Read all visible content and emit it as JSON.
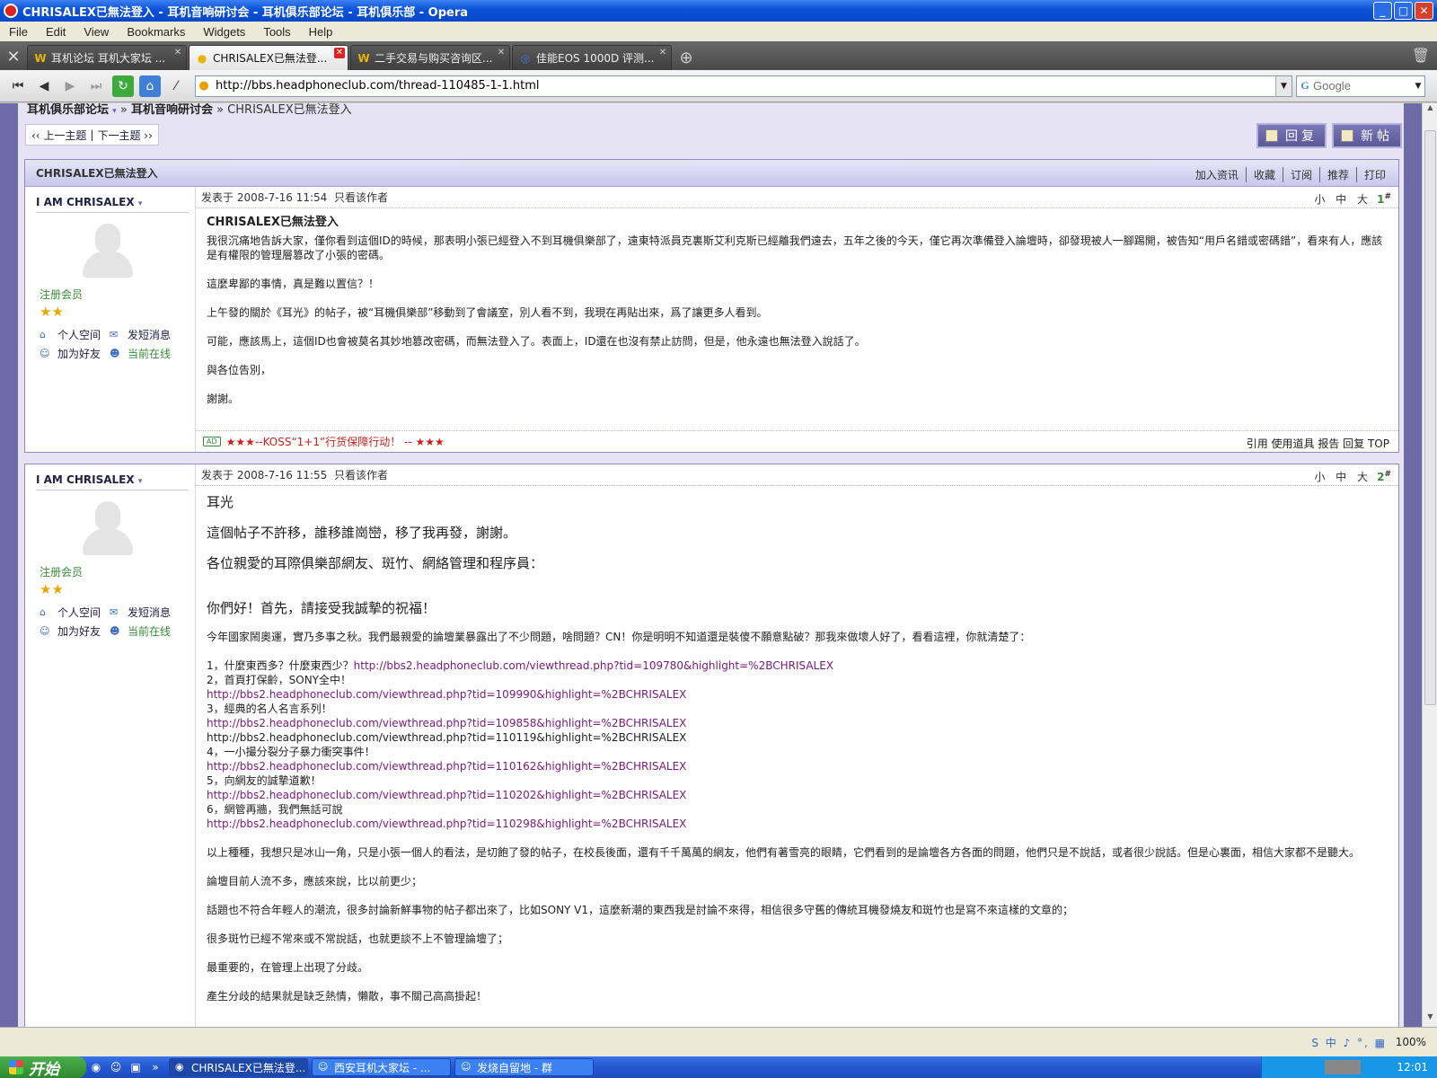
{
  "window": {
    "title": "CHRISALEX已無法登入 - 耳机音响研讨会 - 耳机俱乐部论坛 - 耳机俱乐部 - Opera"
  },
  "menu": [
    "File",
    "Edit",
    "View",
    "Bookmarks",
    "Widgets",
    "Tools",
    "Help"
  ],
  "tabs": [
    {
      "label": "耳机论坛 耳机大家坛 ...",
      "icon": "W"
    },
    {
      "label": "CHRISALEX已無法登...",
      "icon": "●"
    },
    {
      "label": "二手交易与购买咨询区...",
      "icon": "W"
    },
    {
      "label": "佳能EOS 1000D 评测...",
      "icon": "◎"
    }
  ],
  "address": {
    "url": "http://bbs.headphoneclub.com/thread-110485-1-1.html",
    "search_placeholder": "Google"
  },
  "forum": {
    "crumb_root": "耳机俱乐部论坛",
    "crumb_sep1": "»",
    "crumb_board": "耳机音响研讨会",
    "crumb_current": "» CHRISALEX已無法登入",
    "prev_topic": "‹‹ 上一主题",
    "sep": "|",
    "next_topic": "下一主题 ››",
    "reply_btn": "回复",
    "new_btn": "新帖",
    "subject": "CHRISALEX已無法登入",
    "actions": [
      "加入资讯",
      "收藏",
      "订阅",
      "推荐",
      "打印"
    ]
  },
  "author": {
    "name": "I AM CHRISALEX",
    "name_arrow": "▾",
    "group": "注册会员",
    "stars": "★★",
    "space": "个人空间",
    "message": "发短消息",
    "friend": "加为好友",
    "online": "当前在线"
  },
  "post1": {
    "date": "发表于 2008-7-16 11:54",
    "only_author": "只看该作者",
    "sizes": "小 中 大",
    "floor": "1",
    "title": "CHRISALEX已無法登入",
    "p1": "我很沉痛地告訴大家，僅你看到這個ID的時候，那表明小張已經登入不到耳機俱樂部了，遠東特派員克裏斯艾利克斯已經離我們遠去，五年之後的今天，僅它再次準備登入論壇時，卻發現被人一腳踢開，被告知“用戶名錯或密碼錯”，看來有人，應該是有權限的管理層篡改了小張的密碼。",
    "p2": "這麼卑鄙的事情，真是難以置信？！",
    "p3": "上午發的關於《耳光》的帖子，被“耳機俱樂部”移動到了會議室，別人看不到，我現在再貼出來，爲了讓更多人看到。",
    "p4": "可能，應該馬上，這個ID也會被莫名其妙地篡改密碼，而無法登入了。表面上，ID還在也沒有禁止訪問，但是，他永遠也無法登入說話了。",
    "p5": "與各位告別，",
    "p6": "謝謝。",
    "ad_badge": "AD",
    "ad": "★★★--KOSS“1+1”行货保障行动！ -- ★★★",
    "ops": "引用 使用道具 报告 回复 TOP"
  },
  "post2": {
    "date": "发表于 2008-7-16 11:55",
    "only_author": "只看该作者",
    "sizes": "小 中 大",
    "floor": "2",
    "h1": "耳光",
    "h2": "這個帖子不許移，誰移誰崗巒，移了我再發，謝謝。",
    "h3": "各位親愛的耳際俱樂部網友、斑竹、網絡管理和程序員：",
    "h4": "你們好！首先，請接受我誠摯的祝福！",
    "intro": "今年國家鬧奧運，實乃多事之秋。我們最親愛的論壇業暴露出了不少問題，啥問題？CN！你是明明不知道還是裝傻不願意點破？那我來做壞人好了，看看這裡，你就清楚了：",
    "l1a": "1，什麼東西多？什麼東西少？",
    "l1b": "http://bbs2.headphoneclub.com/viewthread.php?tid=109780&highlight=%2BCHRISALEX",
    "l2": "2，首頁打保齡，SONY全中！",
    "l2u": "http://bbs2.headphoneclub.com/viewthread.php?tid=109990&highlight=%2BCHRISALEX",
    "l3": "3，經典的名人名言系列！",
    "l3u": "http://bbs2.headphoneclub.com/viewthread.php?tid=109858&highlight=%2BCHRISALEX",
    "l3u2": "http://bbs2.headphoneclub.com/viewthread.php?tid=110119&highlight=%2BCHRISALEX",
    "l4": "4，一小撮分裂分子暴力衝突事件！",
    "l4u": "http://bbs2.headphoneclub.com/viewthread.php?tid=110162&highlight=%2BCHRISALEX",
    "l5": "5，向網友的誠摯道歉！",
    "l5u": "http://bbs2.headphoneclub.com/viewthread.php?tid=110202&highlight=%2BCHRISALEX",
    "l6": "6，網管再牆，我們無話可說",
    "l6u": "http://bbs2.headphoneclub.com/viewthread.php?tid=110298&highlight=%2BCHRISALEX",
    "p7": "以上種種，我想只是冰山一角，只是小張一個人的看法，是切飽了發的帖子，在校長後面，還有千千萬萬的網友，他們有著雪亮的眼睛，它們看到的是論壇各方各面的問題，他們只是不說話，或者很少說話。但是心裏面，相信大家都不是聽大。",
    "p8": "論壇目前人流不多，應該來說，比以前更少；",
    "p9": "話題也不符合年輕人的潮流，很多討論新鮮事物的帖子都出來了，比如SONY V1，這麼新潮的東西我是討論不來得，相信很多守舊的傳統耳機發燒友和斑竹也是寫不來這樣的文章的；",
    "p10": "很多斑竹已經不常來或不常說話，也就更談不上不管理論壇了；",
    "p11": "最重要的，在管理上出現了分歧。",
    "p12": "產生分歧的結果就是缺乏熱情，懶散，事不關己高高掛起！"
  },
  "status": {
    "zoom": "100%",
    "tray_icons": "S 中 ♪ °, ▦"
  },
  "taskbar": {
    "start": "开始",
    "tasks": [
      "CHRISALEX已無法登...",
      "西安耳机大家坛 - ...",
      "发烧自留地 - 群"
    ],
    "clock": "12:01"
  }
}
